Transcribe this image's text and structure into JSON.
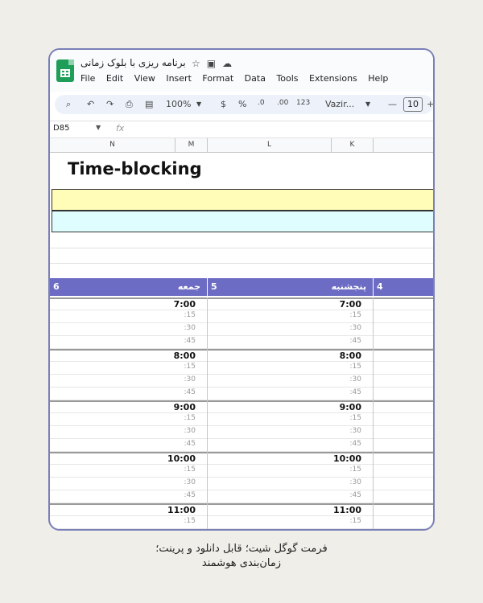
{
  "doc": {
    "title": "برنامه ریزی با بلوک زمانی",
    "icons": [
      "star-icon",
      "move-folder-icon",
      "cloud-status-icon"
    ]
  },
  "menu": [
    "File",
    "Edit",
    "View",
    "Insert",
    "Format",
    "Data",
    "Tools",
    "Extensions",
    "Help"
  ],
  "toolbar": {
    "zoom": "100%",
    "currency": "$",
    "percent": "%",
    "dec_less": ".0",
    "dec_more": ".00",
    "number_format": "123",
    "font": "Vazir...",
    "font_size": "10",
    "minus": "—",
    "plus": "+"
  },
  "formula": {
    "cell": "D85",
    "fx": "fx"
  },
  "columns": [
    "N",
    "M",
    "L",
    "K"
  ],
  "sheet": {
    "title": "Time-blocking"
  },
  "days": [
    {
      "num": "6",
      "name": "جمعه"
    },
    {
      "num": "5",
      "name": "پنجشنبه"
    },
    {
      "num": "4",
      "name": ""
    }
  ],
  "times": [
    "7:00",
    ":15",
    ":30",
    ":45",
    "8:00",
    ":15",
    ":30",
    ":45",
    "9:00",
    ":15",
    ":30",
    ":45",
    "10:00",
    ":15",
    ":30",
    ":45",
    "11:00",
    ":15"
  ],
  "caption": {
    "line1": "فرمت گوگل شیت؛ قابل دانلود و پرینت؛",
    "line2": "زمان‌بندی هوشمند"
  },
  "colors": {
    "accent": "#6c6cc4",
    "yellow": "#fffdb8",
    "cyan": "#dffdff",
    "frame": "#7a7fb8"
  }
}
